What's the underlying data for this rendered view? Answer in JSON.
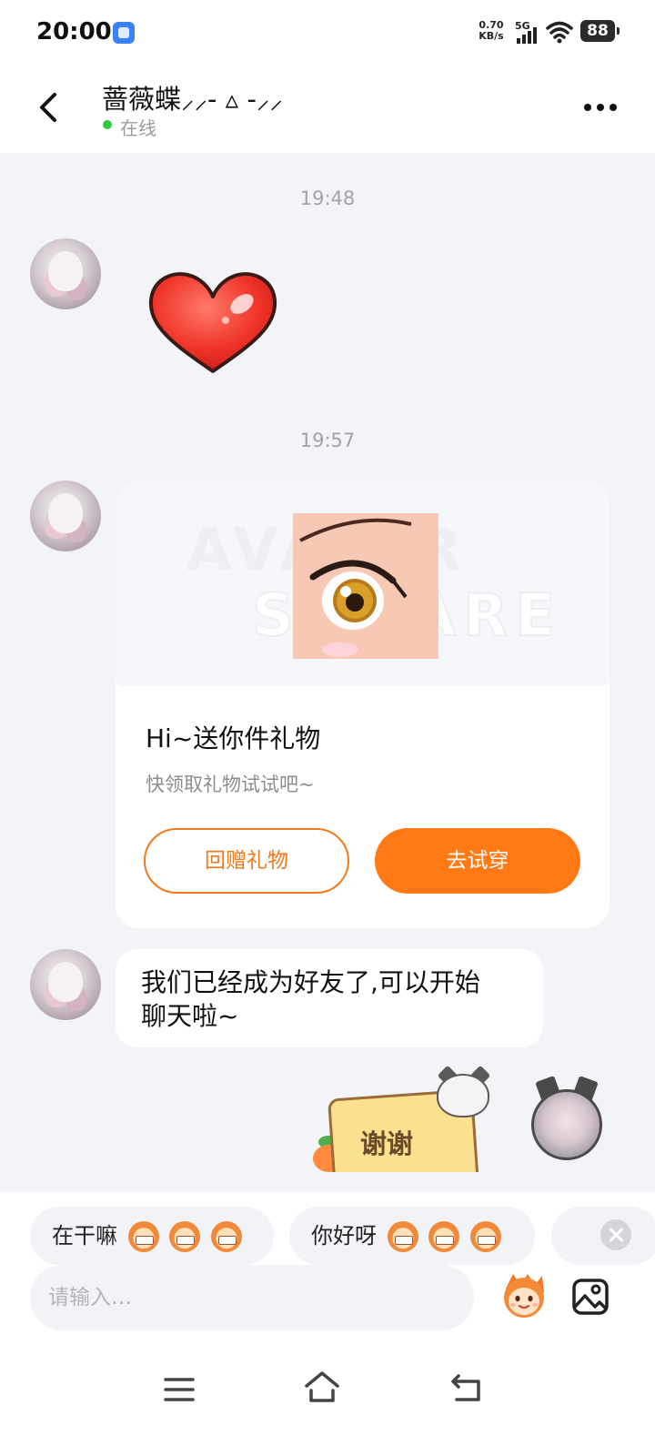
{
  "status_bar": {
    "time": "20:00",
    "net_speed_value": "0.70",
    "net_speed_unit": "KB/s",
    "network_type": "5G",
    "battery": "88",
    "app_icon": "app-notification-icon",
    "signal_icon": "signal-icon",
    "wifi_icon": "wifi-icon"
  },
  "header": {
    "contact_name": "蔷薇蝶⸝⸝- ▵ -⸝⸝",
    "status": "在线",
    "status_color": "#2ecc40",
    "back_icon": "back-arrow-icon",
    "more_icon": "more-dots-icon"
  },
  "messages": [
    {
      "type": "timestamp",
      "text": "19:48"
    },
    {
      "type": "sticker",
      "sender": "contact",
      "sticker": "red-heart-sticker"
    },
    {
      "type": "timestamp",
      "text": "19:57"
    },
    {
      "type": "gift_card",
      "sender": "contact",
      "watermark_line1": "AVATAR",
      "watermark_line2": "SQUARE",
      "title": "Hi~送你件礼物",
      "subtitle": "快领取礼物试试吧~",
      "button_return": "回赠礼物",
      "button_try": "去试穿",
      "accent_color": "#ff7a14"
    },
    {
      "type": "text",
      "sender": "contact",
      "text_line1": "我们已经成为好友了,可以开始",
      "text_line2": "聊天啦~"
    },
    {
      "type": "sticker",
      "sender": "me",
      "sticker": "thanks-cat-sticker",
      "text": "谢谢"
    }
  ],
  "quick_replies": [
    {
      "text": "在干嘛",
      "emoji_count": 3
    },
    {
      "text": "你好呀",
      "emoji_count": 3
    }
  ],
  "composer": {
    "placeholder": "请输入…",
    "emoji_button_icon": "emoji-face-icon",
    "image_button_icon": "image-icon",
    "close_quick_replies_icon": "close-icon"
  },
  "nav_bar": {
    "menu_icon": "menu-icon",
    "home_icon": "home-icon",
    "back_icon": "back-icon"
  }
}
